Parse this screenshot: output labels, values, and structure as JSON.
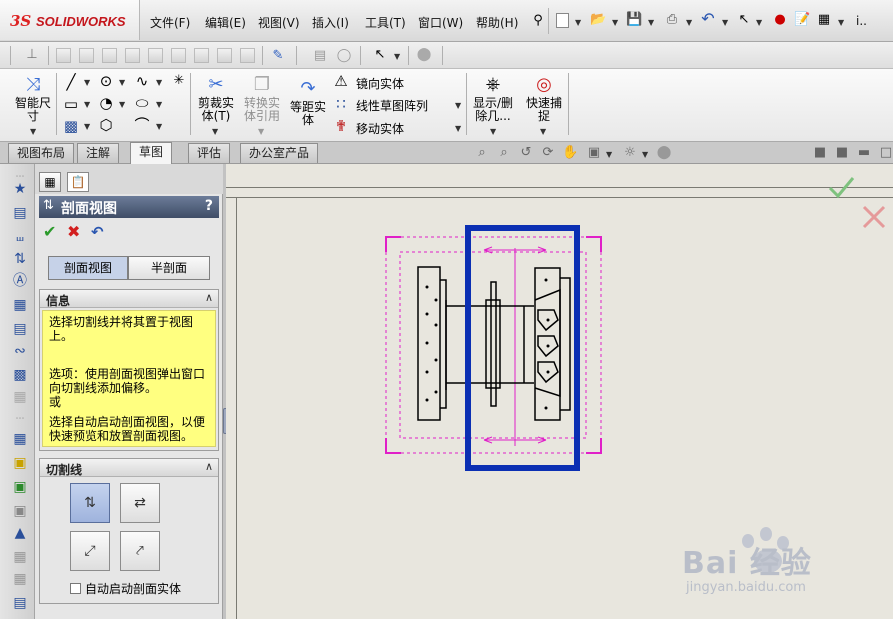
{
  "app": {
    "logo_mark": "3S",
    "logo_text": "SOLIDWORKS"
  },
  "menu": {
    "items": [
      "文件(F)",
      "编辑(E)",
      "视图(V)",
      "插入(I)",
      "工具(T)",
      "窗口(W)",
      "帮助(H)"
    ],
    "extra": "i.."
  },
  "commandmanager": {
    "smart_dim": "智能尺寸",
    "trim": "剪裁实体(T)",
    "convert": "转换实体引用",
    "offset": "等距实体",
    "mirror": "镜向实体",
    "linear_pattern": "线性草图阵列",
    "move": "移动实体",
    "show_hide": "显示/删除几...",
    "quick_snap": "快速捕捉"
  },
  "tabs": [
    "视图布局",
    "注解",
    "草图",
    "评估",
    "办公室产品"
  ],
  "active_tab": "草图",
  "property_manager": {
    "title": "剖面视图",
    "help": "?",
    "toggle_section": "剖面视图",
    "toggle_half": "半剖面",
    "info_title": "信息",
    "info_lines": [
      "选择切割线并将其置于视图上。",
      "",
      "选项：使用剖面视图弹出窗口向切割线添加偏移。",
      "或",
      "",
      "选择自动启动剖面视图，以便快速预览和放置剖面视图。"
    ],
    "cutline_title": "切割线",
    "auto_start_label": "自动启动剖面实体"
  },
  "colors": {
    "selection_box": "#0b2fb3",
    "view_boundary": "#e020c8",
    "ok_green": "#2c9b2c",
    "cancel_red": "#d21f1f",
    "info_yellow": "#ffff80"
  },
  "watermark": {
    "text": "Bai 经验",
    "url": "jingyan.baidu.com"
  }
}
